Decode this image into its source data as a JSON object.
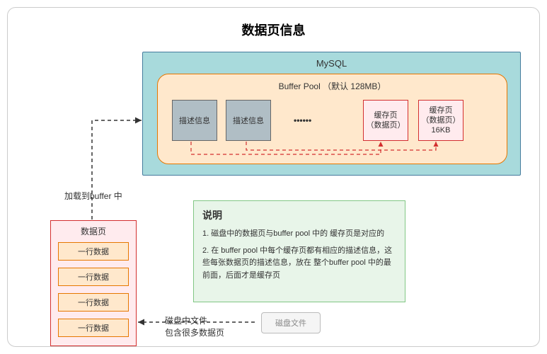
{
  "title": "数据页信息",
  "mysql": {
    "label": "MySQL",
    "buffer_pool": {
      "label": "Buffer Pool  （默认 128MB）",
      "desc1": "描述信息",
      "desc2": "描述信息",
      "dots": "••••••",
      "cache1_l1": "缓存页",
      "cache1_l2": "（数据页）",
      "cache2_l1": "缓存页",
      "cache2_l2": "（数据页）",
      "cache2_l3": "16KB"
    }
  },
  "load_label": "加载到buffer 中",
  "datapage": {
    "label": "数据页",
    "row1": "一行数据",
    "row2": "一行数据",
    "row3": "一行数据",
    "row4": "一行数据"
  },
  "note": {
    "title": "说明",
    "line1": "1. 磁盘中的数据页与buffer pool 中的 缓存页是对应的",
    "line2": "2. 在 buffer pool 中每个缓存页都有相应的描述信息，这些每张数据页的描述信息，放在 整个buffer pool 中的最前面，后面才是缓存页"
  },
  "disk": {
    "label": "磁盘文件",
    "arrow_l1": "磁盘中文件",
    "arrow_l2": "包含很多数据页"
  }
}
